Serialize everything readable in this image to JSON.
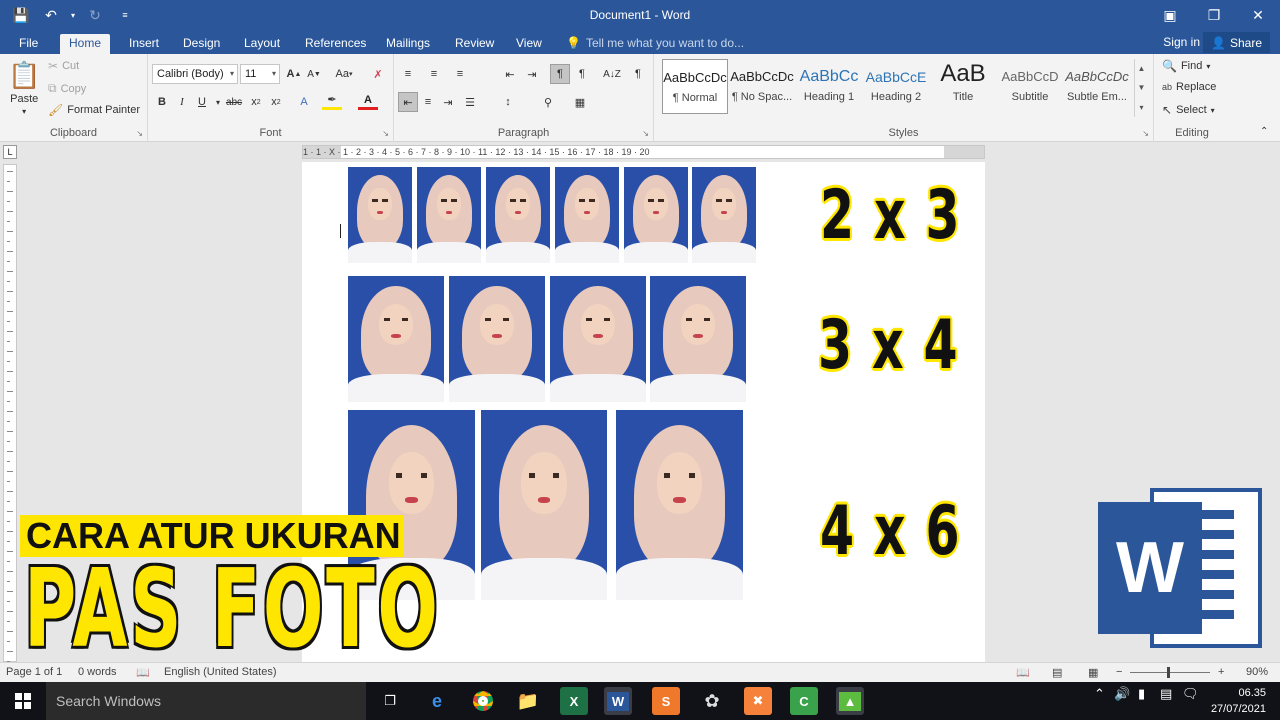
{
  "window": {
    "title": "Document1 - Word",
    "controls": [
      "restore-ribbon",
      "restore",
      "close"
    ]
  },
  "tabs": [
    {
      "label": "File",
      "active": false
    },
    {
      "label": "Home",
      "active": true
    },
    {
      "label": "Insert",
      "active": false
    },
    {
      "label": "Design",
      "active": false
    },
    {
      "label": "Layout",
      "active": false
    },
    {
      "label": "References",
      "active": false
    },
    {
      "label": "Mailings",
      "active": false
    },
    {
      "label": "Review",
      "active": false
    },
    {
      "label": "View",
      "active": false
    }
  ],
  "tell_me": "Tell me what you want to do...",
  "account": {
    "signin": "Sign in",
    "share": "Share"
  },
  "clipboard": {
    "paste": "Paste",
    "cut": "Cut",
    "copy": "Copy",
    "format_painter": "Format Painter",
    "label": "Clipboard"
  },
  "font": {
    "name": "Calibri (Body)",
    "size": "11",
    "label": "Font",
    "case_btn": "Aa",
    "grow": "A",
    "shrink": "A"
  },
  "paragraph": {
    "label": "Paragraph",
    "sort": "A↓Z",
    "pilcrow": "¶"
  },
  "styles": {
    "label": "Styles",
    "items": [
      {
        "preview": "AaBbCcDc",
        "name": "¶ Normal",
        "selected": true
      },
      {
        "preview": "AaBbCcDc",
        "name": "¶ No Spac...",
        "selected": false
      },
      {
        "preview": "AaBbCc",
        "name": "Heading 1",
        "selected": false
      },
      {
        "preview": "AaBbCcE",
        "name": "Heading 2",
        "selected": false
      },
      {
        "preview": "AaB",
        "name": "Title",
        "selected": false
      },
      {
        "preview": "AaBbCcD",
        "name": "Subtitle",
        "selected": false
      },
      {
        "preview": "AaBbCcDc",
        "name": "Subtle Em...",
        "selected": false
      }
    ]
  },
  "editing": {
    "find": "Find",
    "replace": "Replace",
    "select": "Select",
    "label": "Editing"
  },
  "ruler": {
    "marks": "1 · 1 · X · 1 · 2 · 3 · 4 · 5 · 6 · 7 · 8 · 9 · 10 · 11 · 12 · 13 · 14 · 15 · 16 · 17 · 18 · 19 · 20"
  },
  "document": {
    "sizes": {
      "small": "2 x 3",
      "medium": "3 x 4",
      "large": "4 x 6"
    }
  },
  "overlay": {
    "subtitle": "CARA ATUR UKURAN",
    "title": "PAS FOTO",
    "logo_letter": "W"
  },
  "status": {
    "page": "Page 1 of 1",
    "words": "0 words",
    "language": "English (United States)",
    "zoom": "90%"
  },
  "taskbar": {
    "search": "Search Windows",
    "apps": [
      "task-view",
      "edge",
      "chrome",
      "file-explorer",
      "excel",
      "word",
      "sublime",
      "davinci",
      "xampp",
      "camtasia",
      "filmora"
    ],
    "time": "06.35",
    "date": "27/07/2021"
  },
  "colors": {
    "word_blue": "#2b579a",
    "photo_bg": "#2a4fa8",
    "highlight_yellow": "#ffe600"
  }
}
